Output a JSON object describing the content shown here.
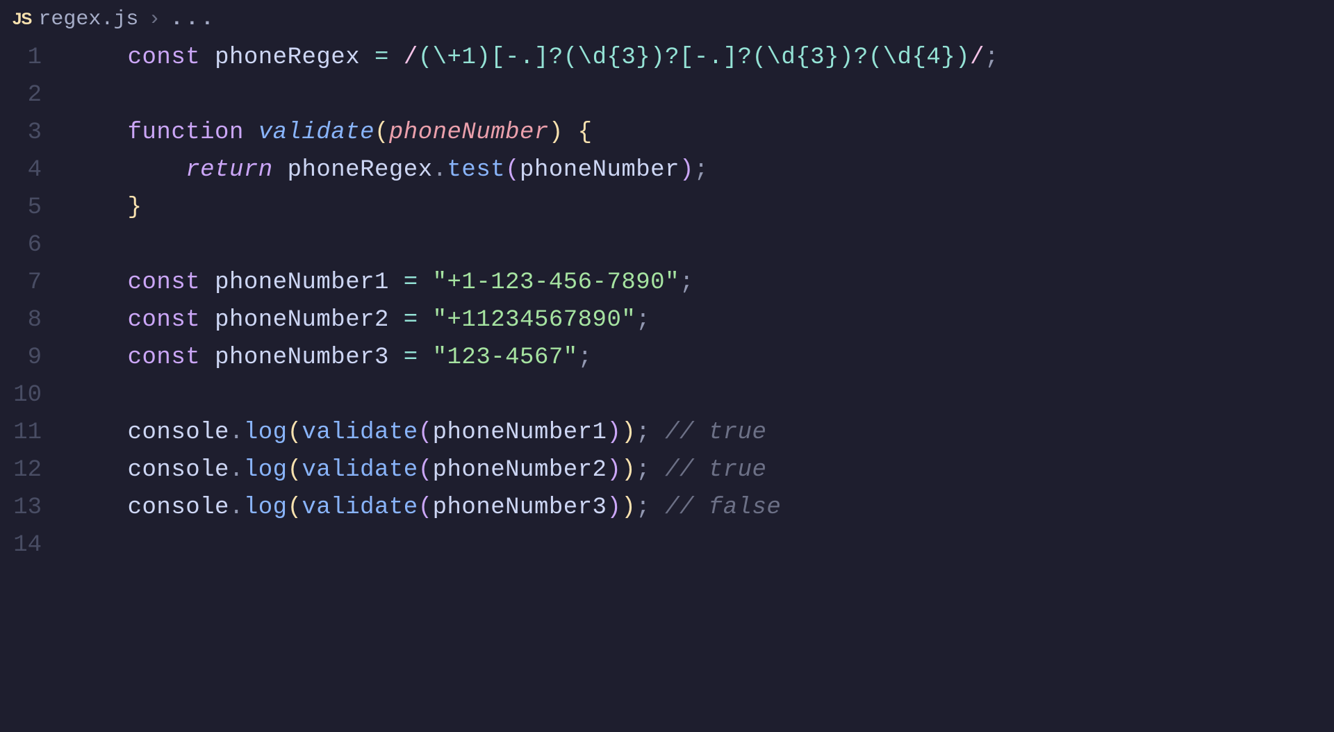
{
  "breadcrumb": {
    "file_icon_label": "JS",
    "file_name": "regex.js",
    "separator": "›",
    "ellipsis": "..."
  },
  "gutter": [
    "1",
    "2",
    "3",
    "4",
    "5",
    "6",
    "7",
    "8",
    "9",
    "10",
    "11",
    "12",
    "13",
    "14"
  ],
  "colors": {
    "bg": "#1e1e2e",
    "keyword": "#cba6f7",
    "function": "#89b4fa",
    "string": "#a6e3a1",
    "regex": "#94e2d5",
    "comment": "#6c7086",
    "param": "#eba0ac",
    "bracket1": "#f9e2af",
    "bracket2": "#cba6f7"
  },
  "source": {
    "line1": "const phoneRegex = /(\\+1)[-.]?(\\d{3})?[-.]?(\\d{3})?(\\d{4})/;",
    "line3": "function validate(phoneNumber) {",
    "line4": "    return phoneRegex.test(phoneNumber);",
    "line5": "}",
    "line7": "const phoneNumber1 = \"+1-123-456-7890\";",
    "line8": "const phoneNumber2 = \"+11234567890\";",
    "line9": "const phoneNumber3 = \"123-4567\";",
    "line11": "console.log(validate(phoneNumber1)); // true",
    "line12": "console.log(validate(phoneNumber2)); // true",
    "line13": "console.log(validate(phoneNumber3)); // false"
  },
  "t": {
    "const": "const",
    "function": "function",
    "return": "return",
    "phoneRegex": "phoneRegex",
    "validate": "validate",
    "phoneNumber": "phoneNumber",
    "phoneNumber1": "phoneNumber1",
    "phoneNumber2": "phoneNumber2",
    "phoneNumber3": "phoneNumber3",
    "console": "console",
    "log": "log",
    "test": "test",
    "eq": " = ",
    "semi": ";",
    "dot": ".",
    "lp": "(",
    "rp": ")",
    "lb": "{",
    "rb": "}",
    "regex_open": "/",
    "regex_body": "(\\+1)[-.]?(\\d{3})?[-.]?(\\d{3})?(\\d{4})",
    "regex_close": "/",
    "str1": "\"+1-123-456-7890\"",
    "str2": "\"+11234567890\"",
    "str3": "\"123-4567\"",
    "cmt_true": "// true",
    "cmt_false": "// false",
    "ind1": "    ",
    "ind2": "        "
  }
}
